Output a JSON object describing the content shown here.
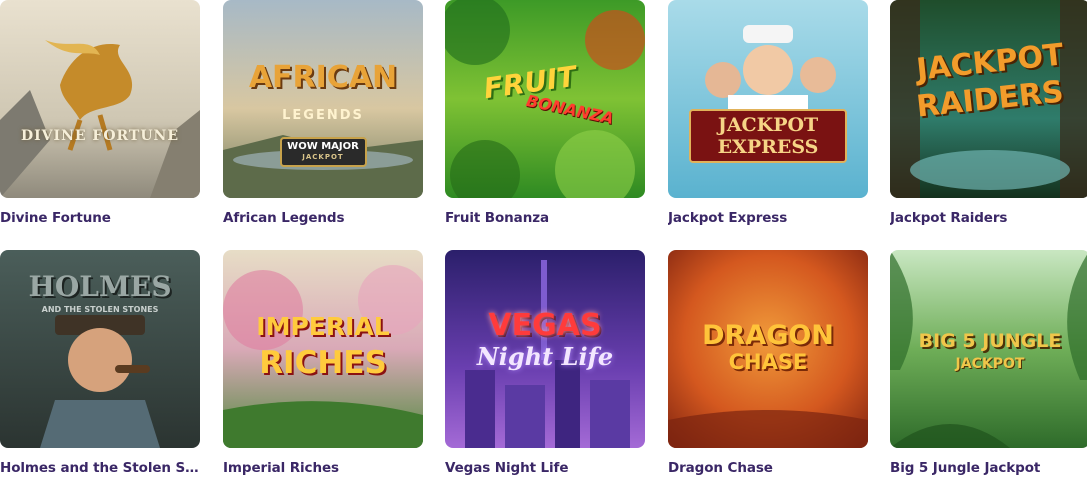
{
  "games": [
    {
      "title": "Divine Fortune",
      "logo": "DIVINE FORTUNE"
    },
    {
      "title": "African Legends",
      "logo_top": "AFRICAN",
      "logo_mid": "LEGENDS",
      "badge_top": "WOW MAJOR",
      "badge_bottom": "JACKPOT"
    },
    {
      "title": "Fruit Bonanza",
      "logo_top": "FRUIT",
      "logo_bottom": "BONANZA"
    },
    {
      "title": "Jackpot Express",
      "logo_top": "JACKPOT",
      "logo_bottom": "EXPRESS"
    },
    {
      "title": "Jackpot Raiders",
      "logo_top": "JACKPOT",
      "logo_bottom": "RAIDERS"
    },
    {
      "title": "Holmes and the Stolen Sto...",
      "logo_top": "HOLMES",
      "logo_bottom": "AND THE STOLEN STONES"
    },
    {
      "title": "Imperial Riches",
      "logo_top": "IMPERIAL",
      "logo_bottom": "RICHES"
    },
    {
      "title": "Vegas Night Life",
      "logo_top": "VEGAS",
      "logo_bottom": "Night Life"
    },
    {
      "title": "Dragon Chase",
      "logo_top": "DRAGON",
      "logo_bottom": "CHASE"
    },
    {
      "title": "Big 5 Jungle Jackpot",
      "logo_top": "BIG 5 JUNGLE",
      "logo_bottom": "JACKPOT"
    }
  ]
}
